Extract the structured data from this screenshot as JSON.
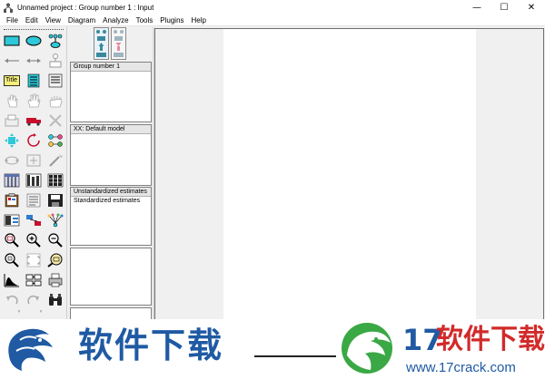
{
  "window": {
    "title": "Unnamed project : Group number 1 : Input",
    "minimize_glyph": "—",
    "maximize_glyph": "☐",
    "close_glyph": "✕"
  },
  "menu": [
    "File",
    "Edit",
    "View",
    "Diagram",
    "Analyze",
    "Tools",
    "Plugins",
    "Help"
  ],
  "toolbox": {
    "title_tool_label": "Title",
    "scroll_glyph": "ᵛ",
    "tools": [
      "draw-observed-variable",
      "draw-unobserved-variable",
      "draw-latent-indicator",
      "draw-path",
      "draw-covariance",
      "draw-unique-variable",
      "figure-caption",
      "list-variables-in-model",
      "list-variables-in-dataset",
      "select-one-object",
      "select-all-objects",
      "deselect-all-objects",
      "duplicate-objects",
      "move-objects",
      "erase-objects",
      "change-shape",
      "rotate-indicators",
      "reflect-indicators",
      "move-parameter-values",
      "reposition-diagram",
      "touch-up-variable",
      "select-data-files",
      "analysis-properties",
      "calculate-estimates",
      "copy-to-clipboard",
      "text-output",
      "save-diagram",
      "object-properties",
      "drag-properties",
      "preserve-symmetries",
      "zoom-selected-area",
      "zoom-in",
      "zoom-out",
      "view-page",
      "fit-to-page",
      "magnifier",
      "bayesian-estimation",
      "multiple-group-analysis",
      "print-diagram",
      "undo",
      "redo",
      "specification-search"
    ]
  },
  "panels": {
    "groups": {
      "items": [
        "Group number 1"
      ]
    },
    "models": {
      "items": [
        "XX: Default model"
      ]
    },
    "estimates": {
      "items": [
        "Unstandardized estimates",
        "Standardized estimates"
      ]
    }
  },
  "watermark": {
    "left_text": "软件下载",
    "right_number": "17",
    "right_text": "软件下载",
    "url": "www.17crack.com"
  },
  "colors": {
    "accent_cyan": "#2ec8d8",
    "watermark_blue": "#1f5aa3",
    "watermark_red": "#d22a2a",
    "watermark_green": "#3aa845"
  }
}
